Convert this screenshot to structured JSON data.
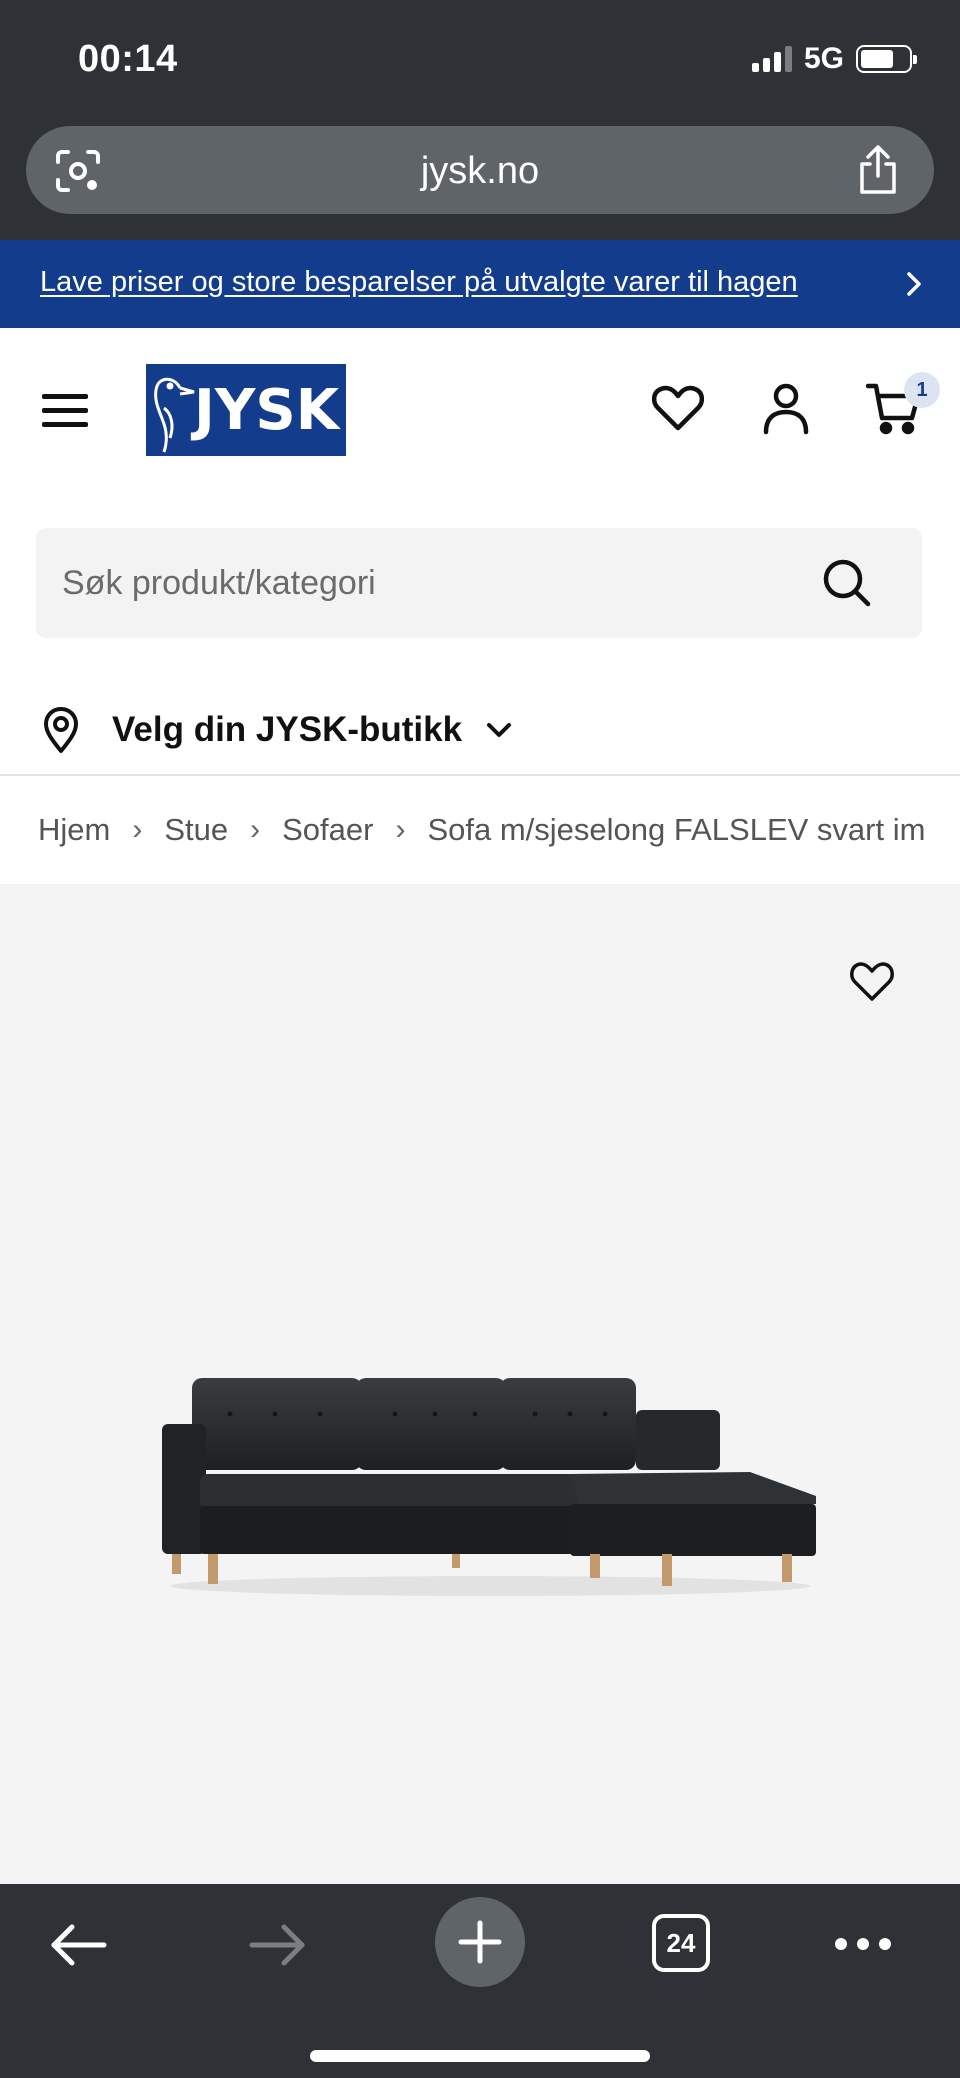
{
  "status_bar": {
    "time": "00:14",
    "network": "5G",
    "battery_level": 0.7
  },
  "browser": {
    "url": "jysk.no",
    "tab_count": "24"
  },
  "promo_banner": {
    "text": "Lave priser og store besparelser på utvalgte varer til hagen"
  },
  "header": {
    "logo_text": "JYSK",
    "cart_count": "1",
    "icons": [
      "menu-icon",
      "heart-icon",
      "user-icon",
      "cart-icon"
    ]
  },
  "search": {
    "placeholder": "Søk produkt/kategori"
  },
  "store_selector": {
    "label": "Velg din JYSK-butikk"
  },
  "breadcrumb": {
    "items": [
      "Hjem",
      "Stue",
      "Sofaer",
      "Sofa m/sjeselong FALSLEV svart imite"
    ]
  },
  "product": {
    "image": "sofa-with-chaise-black"
  },
  "colors": {
    "brand_blue": "#143c8c",
    "browser_chrome": "#2e3135",
    "product_bg": "#f4f4f4"
  }
}
